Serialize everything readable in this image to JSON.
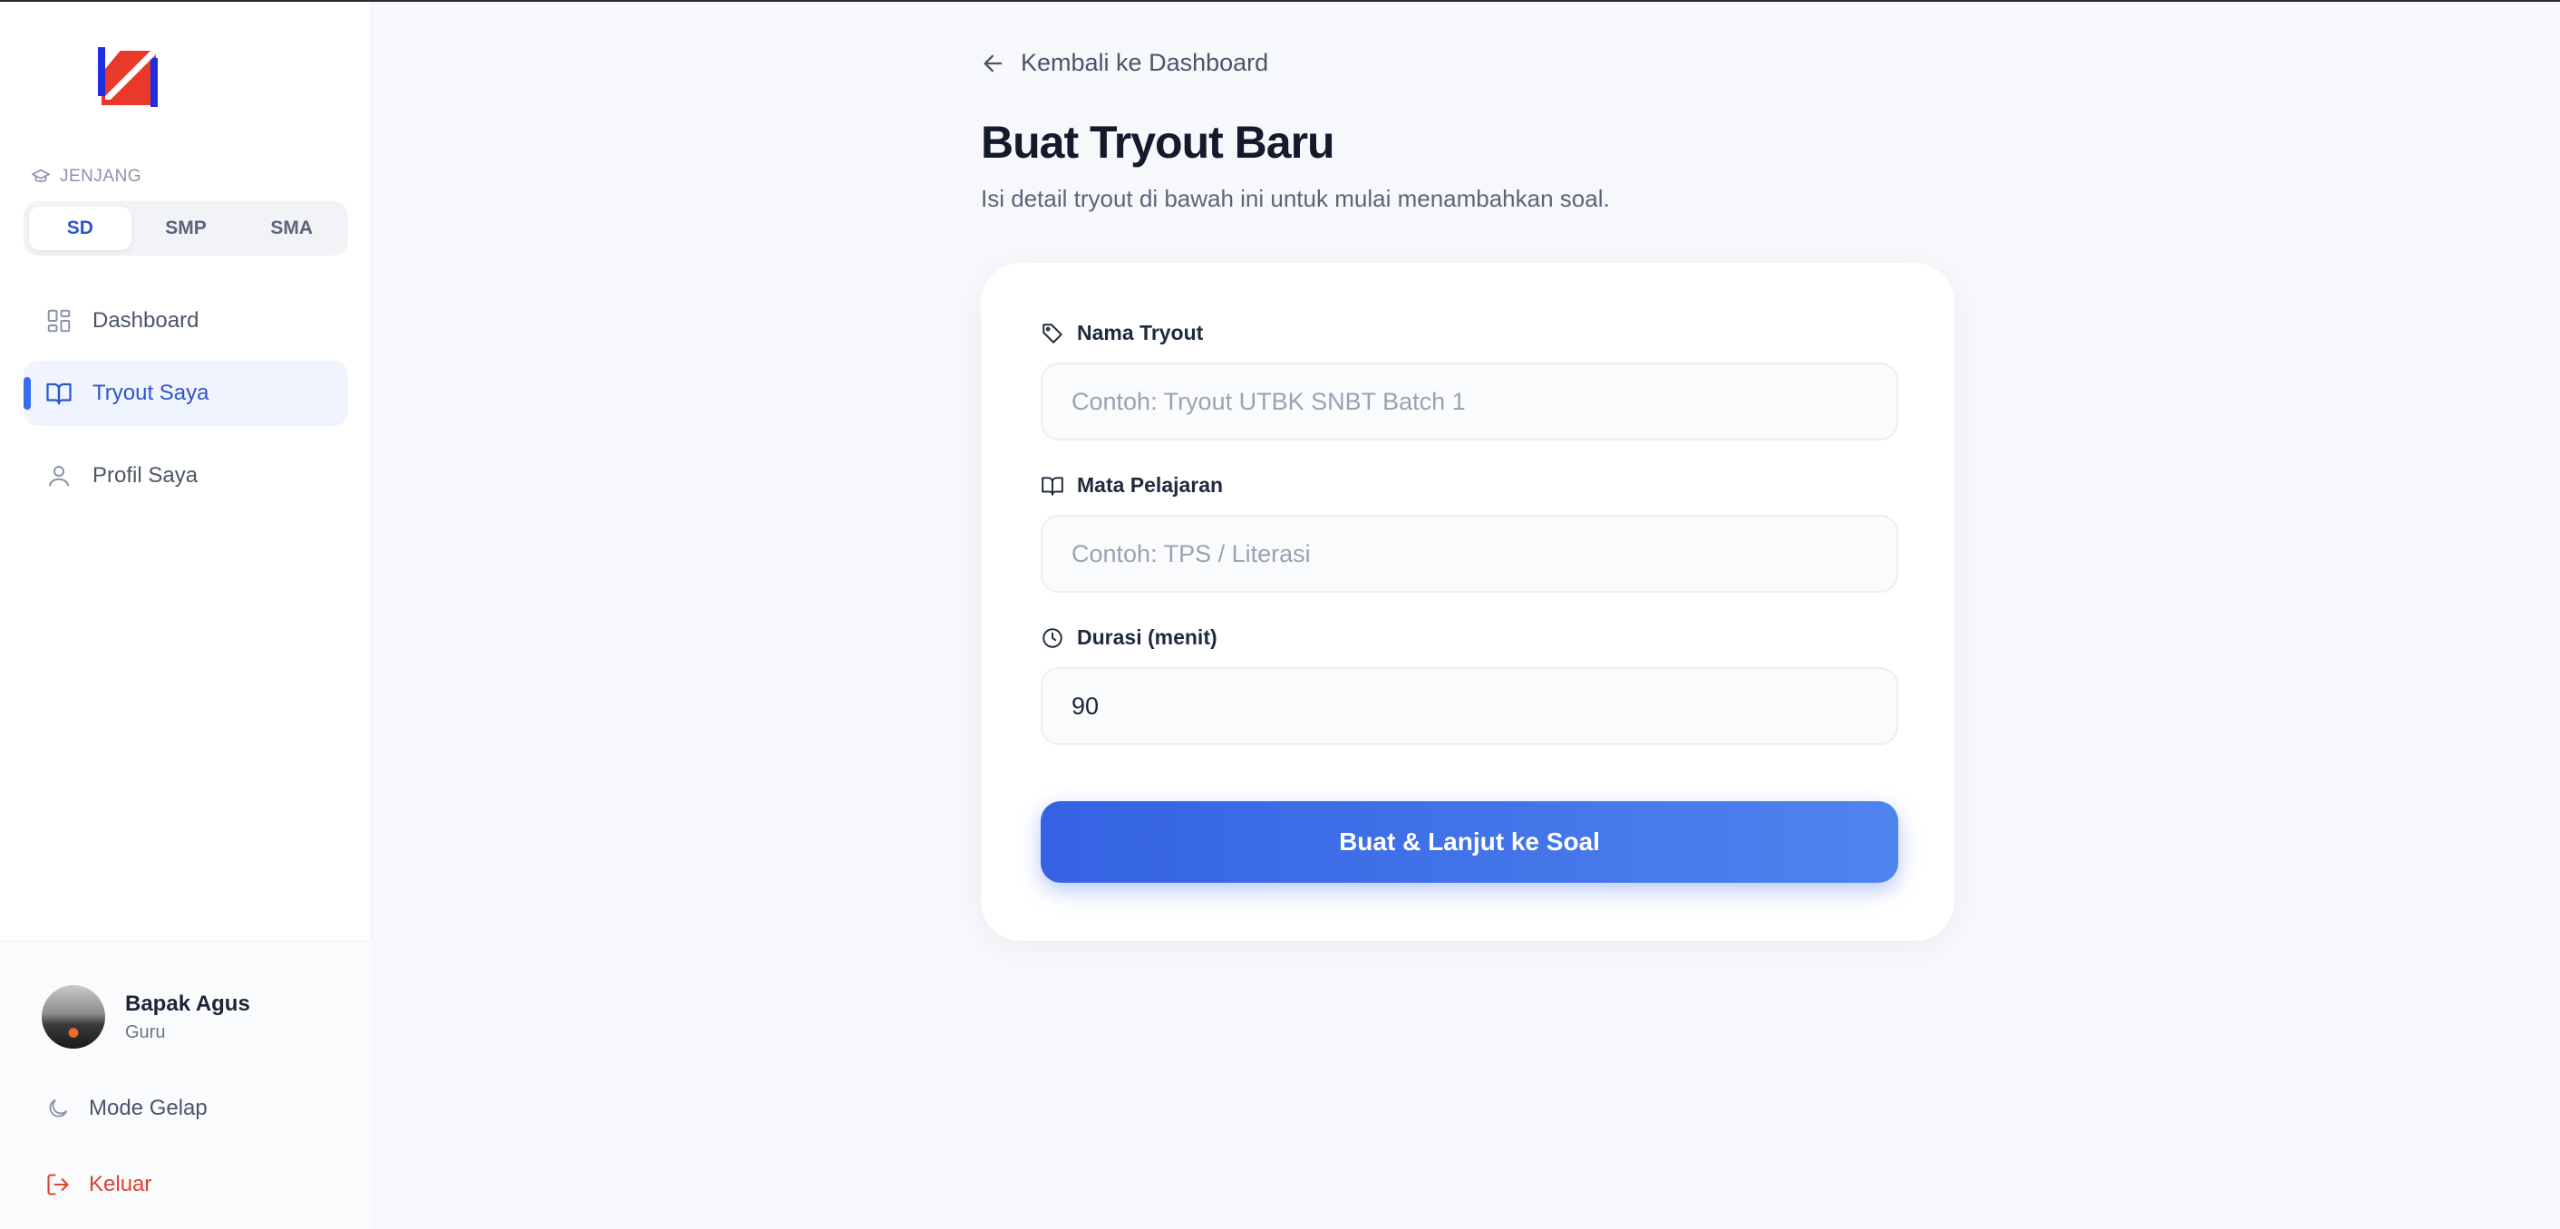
{
  "sidebar": {
    "level_label": "JENJANG",
    "levels": [
      {
        "label": "SD",
        "active": true
      },
      {
        "label": "SMP",
        "active": false
      },
      {
        "label": "SMA",
        "active": false
      }
    ],
    "nav": [
      {
        "label": "Dashboard",
        "icon": "grid-icon",
        "active": false
      },
      {
        "label": "Tryout Saya",
        "icon": "book-icon",
        "active": true
      },
      {
        "label": "Profil Saya",
        "icon": "user-icon",
        "active": false
      }
    ],
    "user": {
      "name": "Bapak Agus",
      "role": "Guru"
    },
    "mode_label": "Mode Gelap",
    "logout_label": "Keluar"
  },
  "main": {
    "back_label": "Kembali ke Dashboard",
    "title": "Buat Tryout Baru",
    "subtitle": "Isi detail tryout di bawah ini untuk mulai menambahkan soal.",
    "form": {
      "nama": {
        "label": "Nama Tryout",
        "placeholder": "Contoh: Tryout UTBK SNBT Batch 1",
        "value": ""
      },
      "mapel": {
        "label": "Mata Pelajaran",
        "placeholder": "Contoh: TPS / Literasi",
        "value": ""
      },
      "durasi": {
        "label": "Durasi (menit)",
        "placeholder": "",
        "value": "90"
      },
      "submit_label": "Buat & Lanjut ke Soal"
    }
  },
  "colors": {
    "accent": "#3b6cf0",
    "danger": "#e0402f",
    "background": "#f7f8fb"
  }
}
